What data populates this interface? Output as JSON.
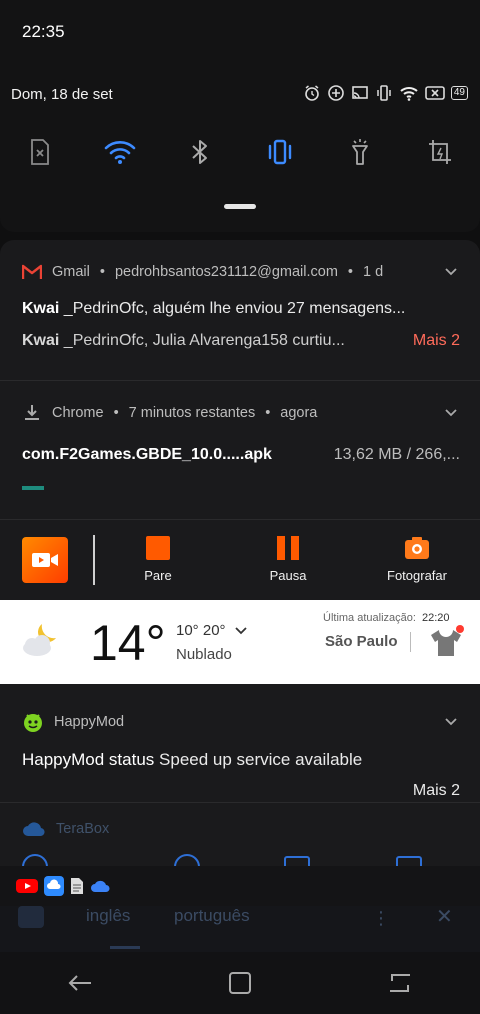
{
  "status": {
    "time": "22:35",
    "date": "Dom, 18 de set",
    "battery": "49"
  },
  "quick_settings": [
    "sim-off-icon",
    "wifi-icon",
    "bluetooth-icon",
    "vibrate-icon",
    "flashlight-icon",
    "screenshot-icon"
  ],
  "gmail": {
    "app": "Gmail",
    "account": "pedrohbsantos231112@gmail.com",
    "age": "1 d",
    "line1_bold": "Kwai",
    "line1_rest": " _PedrinOfc, alguém lhe enviou 27 mensagens...",
    "line2_bold": "Kwai",
    "line2_rest": " _PedrinOfc, Julia Alvarenga158 curtiu...",
    "more": "Mais 2",
    "accent": "#ea4335"
  },
  "chrome": {
    "app": "Chrome",
    "remaining": "7 minutos restantes",
    "when": "agora",
    "file": "com.F2Games.GBDE_10.0.....apk",
    "progress_text": "13,62 MB / 266,...",
    "progress": 0.05,
    "accent": "#1e8c7e"
  },
  "recorder": {
    "stop": "Pare",
    "pause": "Pausa",
    "photo": "Fotografar",
    "accent": "#ff5a00"
  },
  "weather": {
    "temp": "14°",
    "range": "10° 20°",
    "condition": "Nublado",
    "updated_label": "Última atualização:",
    "updated_time": "22:20",
    "city": "São Paulo"
  },
  "happymod": {
    "app": "HappyMod",
    "title_bold": "HappyMod status",
    "title_rest": " Speed up service available",
    "more": "Mais 2"
  },
  "terabox": {
    "app": "TeraBox"
  },
  "behind": {
    "tab1": "inglês",
    "tab2": "português"
  }
}
